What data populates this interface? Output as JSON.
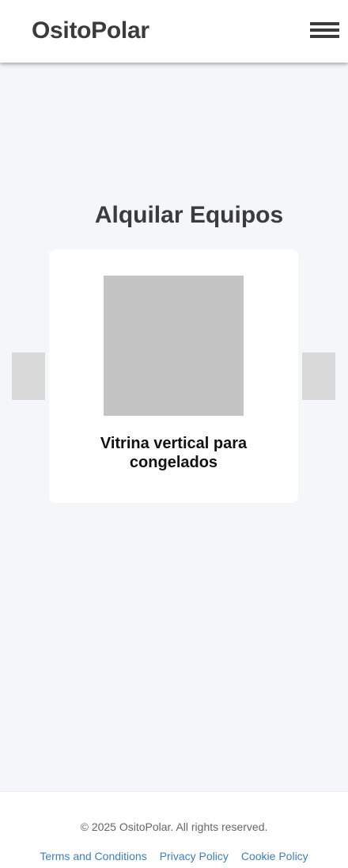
{
  "header": {
    "logo": "OsitoPolar",
    "menu_icon": "hamburger-menu-icon"
  },
  "main": {
    "title": "Alquilar Equipos",
    "carousel": {
      "prev_icon": "carousel-prev-arrow",
      "next_icon": "carousel-next-arrow",
      "items": [
        {
          "title": "Vitrina vertical para congelados"
        }
      ]
    }
  },
  "footer": {
    "copyright": "© 2025 OsitoPolar. All rights reserved.",
    "links": [
      "Terms and Conditions",
      "Privacy Policy",
      "Cookie Policy"
    ]
  },
  "colors": {
    "page_bg": "#f5f6fa",
    "text_dark": "#3b3b3b",
    "link": "#3d7ebd",
    "placeholder": "#c4c4c4"
  }
}
